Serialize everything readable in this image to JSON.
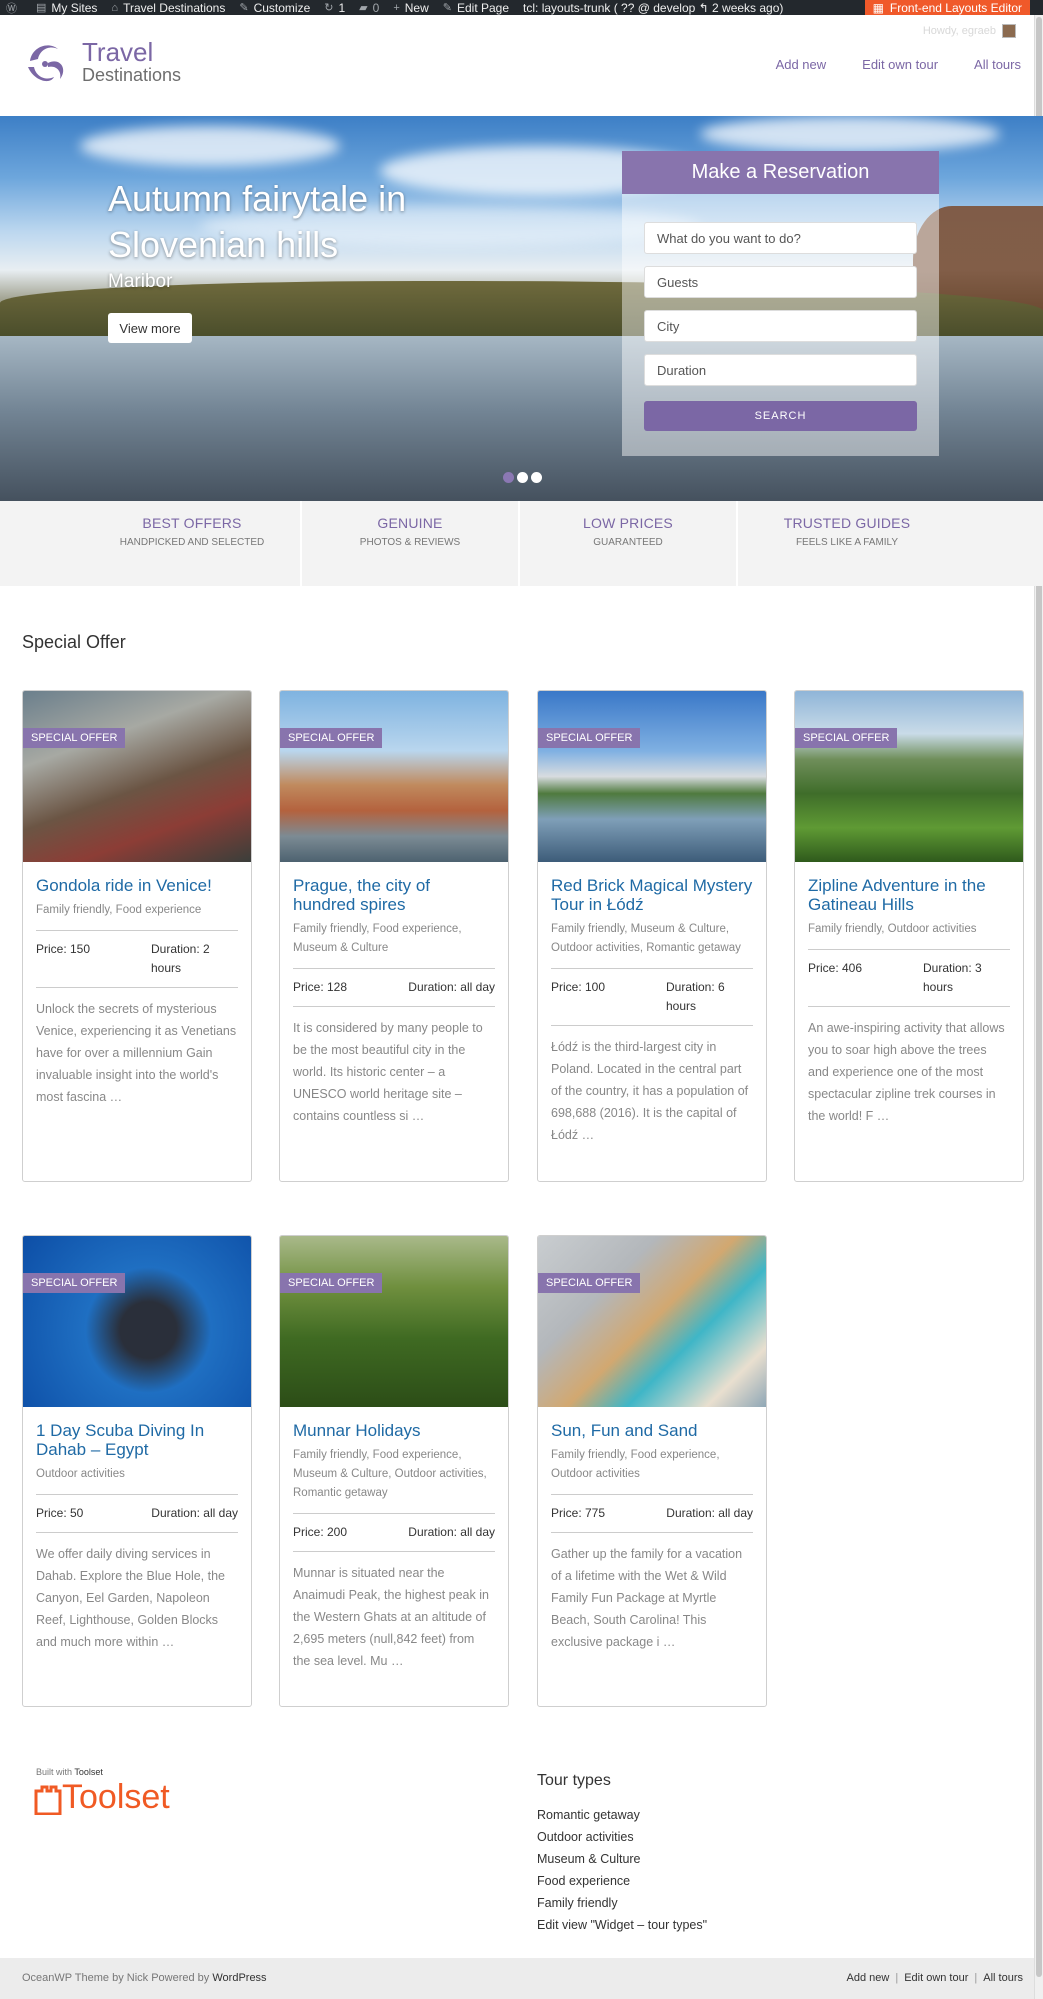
{
  "adminbar": {
    "wp_logo": "wordpress-icon",
    "my_sites": "My Sites",
    "site_name": "Travel Destinations",
    "customize": "Customize",
    "updates_count": "1",
    "comments_count": "0",
    "new": "New",
    "edit_page": "Edit Page",
    "branch": "tcl: layouts-trunk ( ?? @ develop ↰ 2 weeks ago)",
    "front_end_editor": "Front-end Layouts Editor",
    "howdy": "Howdy, egraeb"
  },
  "header": {
    "logo_line1": "Travel",
    "logo_line2": "Destinations",
    "nav": [
      "Add new",
      "Edit own tour",
      "All tours"
    ]
  },
  "hero": {
    "title": "Autumn fairytale in Slovenian hills",
    "subtitle": "Maribor",
    "button": "View more",
    "slide_count": 3,
    "active_slide": 1
  },
  "reservation": {
    "title": "Make a Reservation",
    "fields": [
      "What do you want to do?",
      "Guests",
      "City",
      "Duration"
    ],
    "button": "SEARCH"
  },
  "features": [
    {
      "title": "BEST OFFERS",
      "subtitle": "HANDPICKED AND SELECTED"
    },
    {
      "title": "GENUINE",
      "subtitle": "PHOTOS & REVIEWS"
    },
    {
      "title": "LOW PRICES",
      "subtitle": "GUARANTEED"
    },
    {
      "title": "TRUSTED GUIDES",
      "subtitle": "FEELS LIKE A FAMILY"
    }
  ],
  "special_offer": {
    "heading": "Special Offer",
    "badge": "SPECIAL OFFER",
    "cards": [
      {
        "title": "Gondola ride in Venice!",
        "cats": "Family friendly, Food experience",
        "price": "Price: 150",
        "duration": "Duration: 2 hours",
        "desc": "Unlock the secrets of mysterious Venice, experiencing it as Venetians have for over a millennium Gain invaluable insight into the world's most fascina …"
      },
      {
        "title": "Prague, the city of hundred spires",
        "cats": "Family friendly, Food experience, Museum & Culture",
        "price": "Price: 128",
        "duration": "Duration: all day",
        "desc": "It is considered by many people to be the most beautiful city in the world. Its historic center – a UNESCO world heritage site – contains countless si …"
      },
      {
        "title": "Red Brick Magical Mystery Tour in Łódź",
        "cats": "Family friendly, Museum & Culture, Outdoor activities, Romantic getaway",
        "price": "Price: 100",
        "duration": "Duration: 6 hours",
        "desc": "Łódź is the third-largest city in Poland. Located in the central part of the country, it has a population of 698,688 (2016). It is the capital of Łódź …"
      },
      {
        "title": "Zipline Adventure in the Gatineau Hills",
        "cats": "Family friendly, Outdoor activities",
        "price": "Price: 406",
        "duration": "Duration: 3 hours",
        "desc": "An awe-inspiring activity that allows you to soar high above the trees and experience one of the most spectacular zipline trek courses in the world! F …"
      },
      {
        "title": "1 Day Scuba Diving In Dahab – Egypt",
        "cats": "Outdoor activities",
        "price": "Price: 50",
        "duration": "Duration: all day",
        "desc": "We offer daily diving services in Dahab. Explore the Blue Hole, the Canyon, Eel Garden, Napoleon Reef, Lighthouse, Golden Blocks and much more within …"
      },
      {
        "title": "Munnar Holidays",
        "cats": "Family friendly, Food experience, Museum & Culture, Outdoor activities, Romantic getaway",
        "price": "Price: 200",
        "duration": "Duration: all day",
        "desc": "Munnar is situated near the Anaimudi Peak, the highest peak in the Western Ghats at an altitude of 2,695 meters (null,842 feet) from the sea level. Mu …"
      },
      {
        "title": "Sun, Fun and Sand",
        "cats": "Family friendly, Food experience, Outdoor activities",
        "price": "Price: 775",
        "duration": "Duration: all day",
        "desc": "Gather up the family for a vacation of a lifetime with the Wet & Wild Family Fun Package at Myrtle Beach, South Carolina! This exclusive package i …"
      }
    ]
  },
  "toolset": {
    "built_with": "Built with",
    "built_with_brand": "Toolset",
    "logo_text": "Toolset"
  },
  "tour_types": {
    "heading": "Tour types",
    "items": [
      "Romantic getaway",
      "Outdoor activities",
      "Museum & Culture",
      "Food experience",
      "Family friendly",
      "Edit view \"Widget – tour types\""
    ]
  },
  "footer": {
    "credit": "OceanWP Theme by Nick Powered by",
    "credit_link": "WordPress",
    "links": [
      "Add new",
      "Edit own tour",
      "All tours"
    ]
  }
}
